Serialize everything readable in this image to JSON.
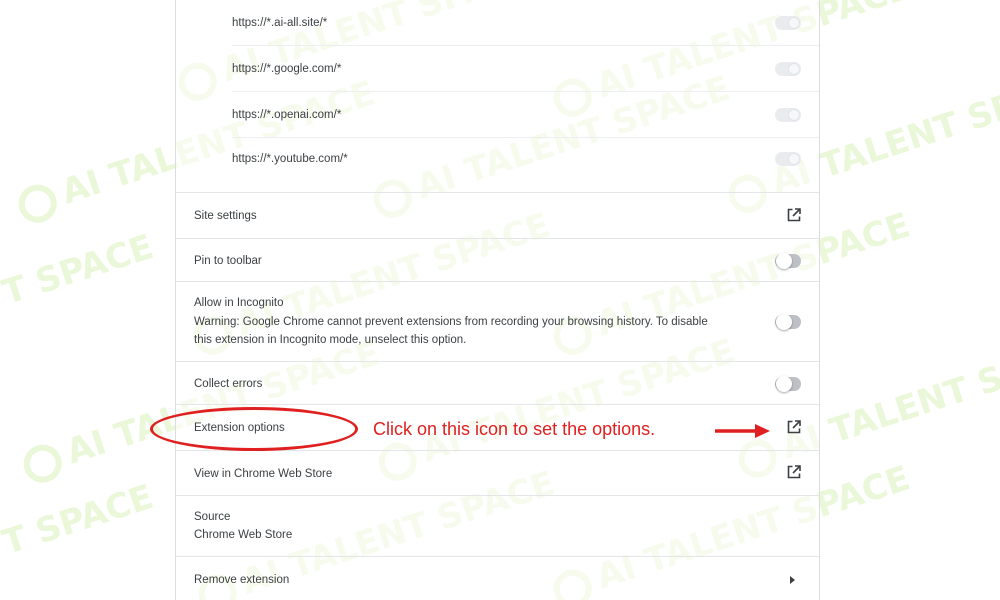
{
  "site_access": {
    "sites": [
      {
        "pattern": "https://*.ai-all.site/*"
      },
      {
        "pattern": "https://*.google.com/*"
      },
      {
        "pattern": "https://*.openai.com/*"
      },
      {
        "pattern": "https://*.youtube.com/*"
      }
    ]
  },
  "settings": {
    "site_settings_label": "Site settings",
    "pin_to_toolbar_label": "Pin to toolbar",
    "incognito_title": "Allow in Incognito",
    "incognito_warning_line1": "Warning: Google Chrome cannot prevent extensions from recording your browsing history. To disable",
    "incognito_warning_line2": "this extension in Incognito mode, unselect this option.",
    "collect_errors_label": "Collect errors",
    "extension_options_label": "Extension options",
    "web_store_label": "View in Chrome Web Store",
    "source_title": "Source",
    "source_value": "Chrome Web Store",
    "remove_label": "Remove extension"
  },
  "annotation": {
    "text": "Click on this icon to set the options.",
    "color": "#e02020"
  },
  "watermark": {
    "text": "AI TALENT SPACE",
    "fragment": "T SPACE"
  },
  "icons": {
    "external": "open-in-new-icon",
    "chevron": "chevron-right-icon"
  }
}
